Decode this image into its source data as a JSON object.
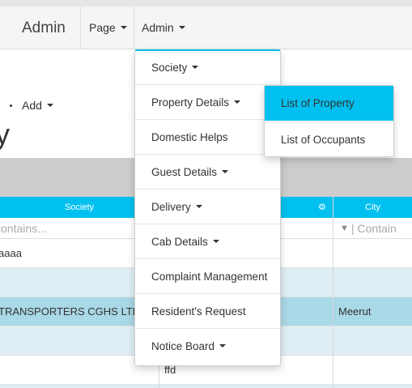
{
  "navbar": {
    "brand": "Admin",
    "page_menu": "Page",
    "admin_menu": "Admin"
  },
  "toolbar": {
    "add_label": "Add"
  },
  "page_title_fragment": "y",
  "table": {
    "columns": [
      "Society",
      "City"
    ],
    "filters": {
      "society_placeholder": "contains...",
      "city_placeholder": "Contain"
    },
    "rows": [
      {
        "society": "aaaa",
        "middle": "",
        "city": ""
      },
      {
        "society": "",
        "middle": "",
        "city": ""
      },
      {
        "society": "TRANSPORTERS CGHS LTD",
        "middle": "",
        "city": "Meerut"
      },
      {
        "society": "",
        "middle": "",
        "city": ""
      },
      {
        "society": "",
        "middle": "ffd",
        "city": ""
      }
    ]
  },
  "admin_menu_items": [
    {
      "label": "Society",
      "has_submenu": true
    },
    {
      "label": "Property Details",
      "has_submenu": true
    },
    {
      "label": "Domestic Helps",
      "has_submenu": false
    },
    {
      "label": "Guest Details",
      "has_submenu": true
    },
    {
      "label": "Delivery",
      "has_submenu": true
    },
    {
      "label": "Cab Details",
      "has_submenu": true
    },
    {
      "label": "Complaint Management",
      "has_submenu": false
    },
    {
      "label": "Resident's Request",
      "has_submenu": false
    },
    {
      "label": "Notice Board",
      "has_submenu": true
    }
  ],
  "property_submenu": [
    {
      "label": "List of Property",
      "active": true
    },
    {
      "label": "List of Occupants",
      "active": false
    }
  ],
  "colors": {
    "accent": "#00c0ef",
    "row_highlight": "#a9d8e6",
    "row_alt": "#deeef4",
    "grey_band": "#cccccc"
  }
}
